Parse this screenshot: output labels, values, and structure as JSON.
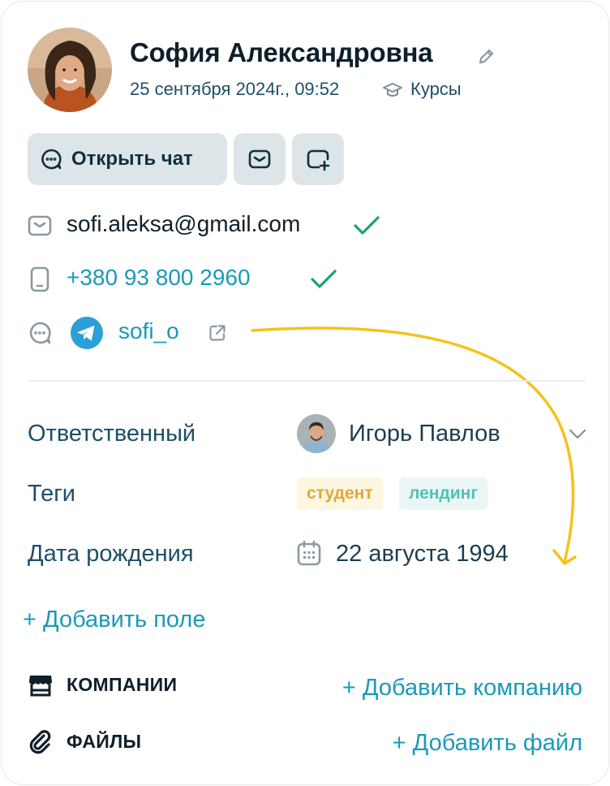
{
  "contact": {
    "name": "София Александровна",
    "date": "25 сентября 2024г., 09:52",
    "course": "Курсы"
  },
  "actions": {
    "open_chat": "Открыть чат"
  },
  "contacts": {
    "email": "sofi.aleksa@gmail.com",
    "phone": "+380 93 800 2960",
    "telegram": "sofi_o"
  },
  "fields": {
    "responsible_label": "Ответственный",
    "responsible_value": "Игорь Павлов",
    "tags_label": "Теги",
    "tags": [
      "студент",
      "лендинг"
    ],
    "birth_label": "Дата рождения",
    "birth_value": "22 августа 1994",
    "add_field": "+ Добавить поле"
  },
  "sections": {
    "companies_title": "КОМПАНИИ",
    "add_company": "+ Добавить компанию",
    "files_title": "ФАЙЛЫ",
    "add_file": "+ Добавить файл"
  },
  "colors": {
    "accent": "#1a9ab8",
    "verified": "#1aa56a",
    "tag_student": "#e5a73a",
    "tag_landing": "#51c1b5",
    "arrow": "#f5c21b"
  }
}
